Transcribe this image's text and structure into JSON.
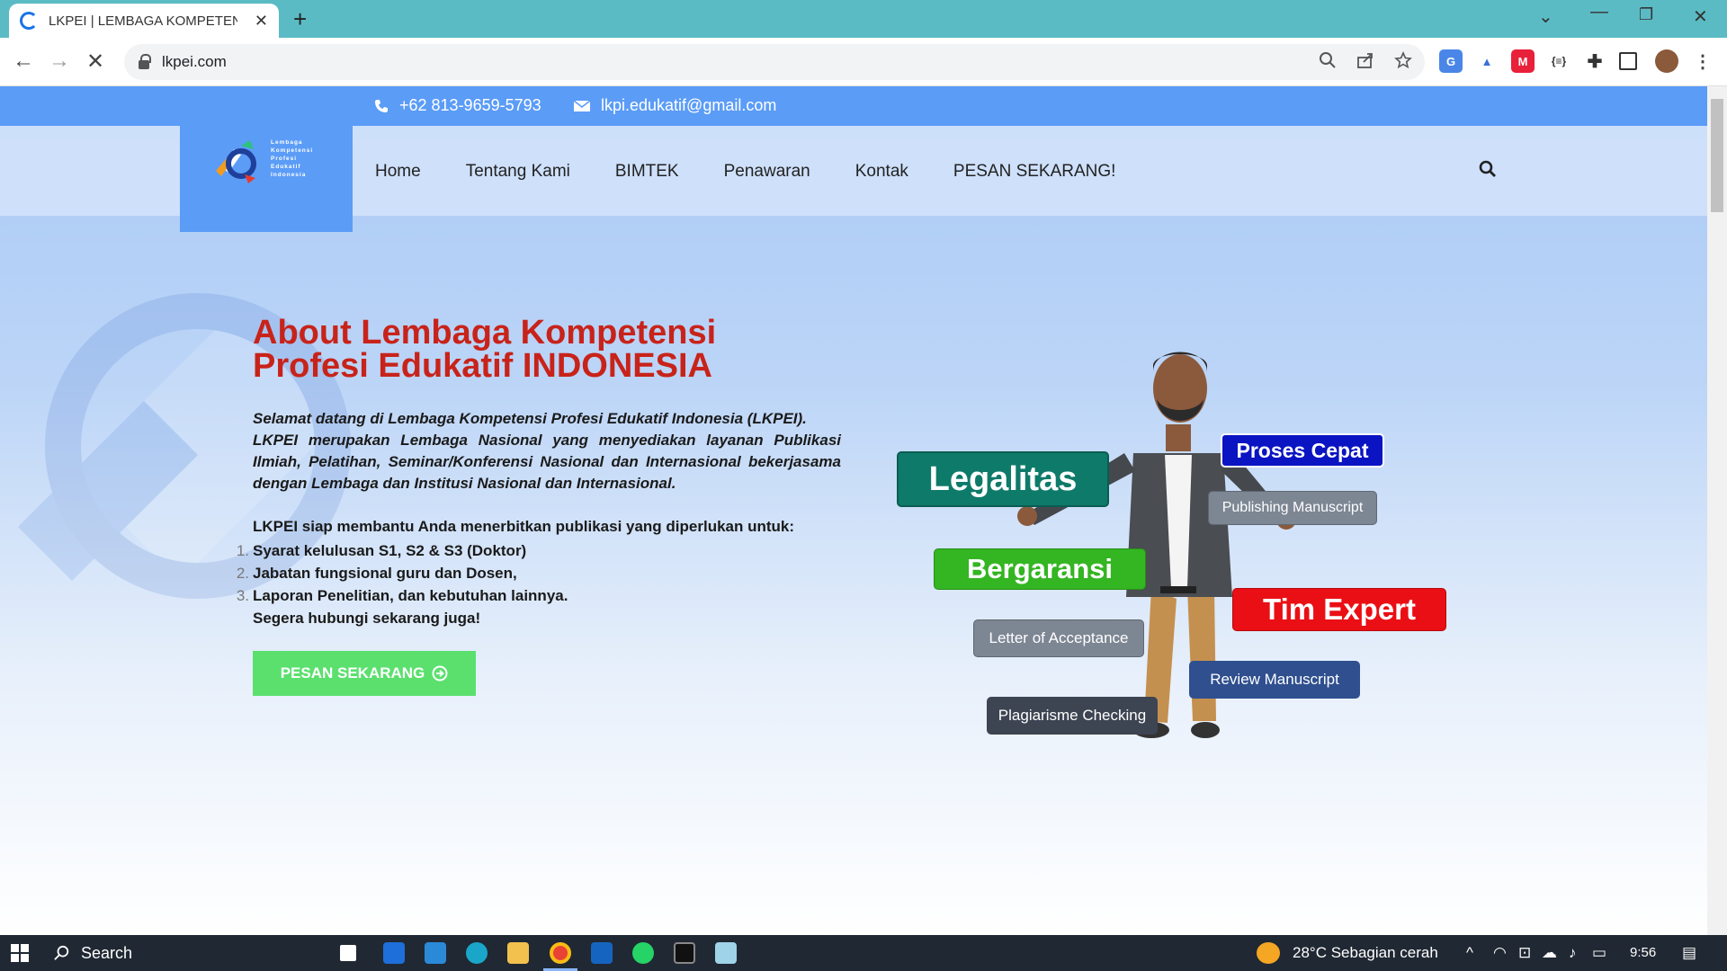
{
  "browser": {
    "tab_title": "LKPEI | LEMBAGA KOMPETENSI P",
    "url": "lkpei.com"
  },
  "site": {
    "topbar": {
      "phone": "+62 813-9659-5793",
      "email": "lkpi.edukatif@gmail.com"
    },
    "logo_text": [
      "Lembaga",
      "Kompetensi",
      "Profesi",
      "Edukatif",
      "Indonesia"
    ],
    "nav": [
      "Home",
      "Tentang Kami",
      "BIMTEK",
      "Penawaran",
      "Kontak",
      "PESAN SEKARANG!"
    ],
    "about": {
      "title_line1": "About Lembaga Kompetensi",
      "title_line2": "Profesi Edukatif INDONESIA",
      "intro_line1": "Selamat datang di Lembaga Kompetensi Profesi Edukatif Indonesia (LKPEI).",
      "intro_line2": "LKPEI merupakan Lembaga Nasional yang menyediakan layanan Publikasi Ilmiah, Pelatihan, Seminar/Konferensi Nasional dan Internasional bekerjasama dengan Lembaga dan Institusi Nasional dan Internasional.",
      "lead": "LKPEI siap membantu Anda menerbitkan publikasi yang diperlukan untuk:",
      "items": [
        "Syarat kelulusan S1, S2 & S3 (Doktor)",
        "Jabatan fungsional guru dan Dosen,",
        "Laporan Penelitian, dan kebutuhan lainnya."
      ],
      "closing": "Segera hubungi sekarang juga!",
      "cta_label": "PESAN SEKARANG"
    },
    "tags": {
      "legalitas": "Legalitas",
      "proses_cepat": "Proses Cepat",
      "publishing": "Publishing Manuscript",
      "bergaransi": "Bergaransi",
      "tim_expert": "Tim Expert",
      "loa": "Letter of Acceptance",
      "review": "Review Manuscript",
      "plagiarisme": "Plagiarisme Checking"
    }
  },
  "taskbar": {
    "search_label": "Search",
    "weather": "28°C  Sebagian cerah",
    "time": "9:56"
  },
  "colors": {
    "topbar": "#5b9cf7",
    "title_red": "#c8231a",
    "cta_green": "#5be06e",
    "legalitas": "#0e7a6a",
    "proses_cepat": "#0a14c2",
    "bergaransi": "#34b522",
    "tim_expert": "#ea0f14",
    "review": "#2f4f8f",
    "gray_tag": "#7d8693",
    "dark_tag": "#3d4452"
  }
}
